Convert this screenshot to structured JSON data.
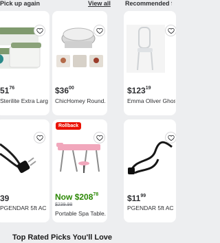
{
  "top": {
    "left_text": "Pick up again",
    "middle_link": "View all",
    "right_text": "Recommended for"
  },
  "products": [
    {
      "price_dollars": "51",
      "price_cents": "76",
      "name": "Sterilite Extra Large..."
    },
    {
      "price_dollars": "$36",
      "price_cents": "00",
      "name": "ChicHomey Round..."
    },
    {
      "price_dollars": "$123",
      "price_cents": "19",
      "name": "Emma  Oliver Ghost"
    },
    {
      "price_dollars": "39",
      "price_cents": "",
      "name": "PGENDAR 5ft AC Po..."
    },
    {
      "badge": "Rollback",
      "now_label": "Now",
      "price_dollars": "$208",
      "price_cents": "78",
      "was_price": "$239.98",
      "name": "Portable Spa Table..."
    },
    {
      "price_dollars": "$11",
      "price_cents": "99",
      "name": "PGENDAR 5ft AC Po..."
    }
  ],
  "section_heading": "Top Rated Picks You'll Love",
  "colors": {
    "rollback": "#ea1100",
    "now_price": "#2a8703",
    "background": "#edeef0"
  }
}
